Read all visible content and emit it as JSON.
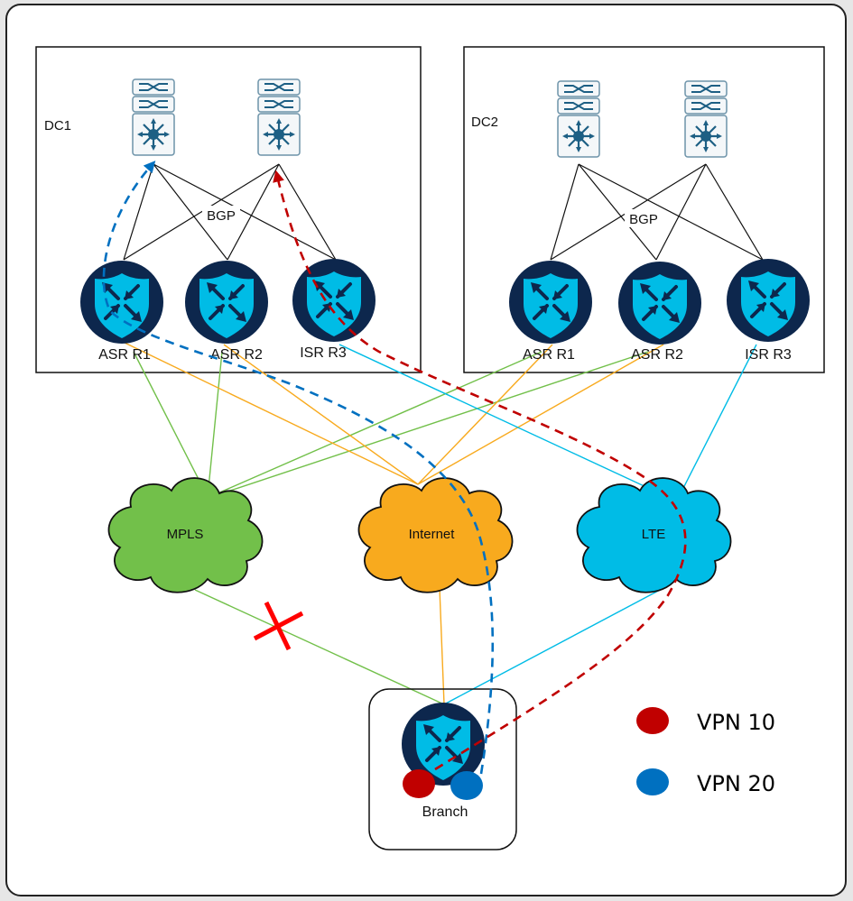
{
  "colors": {
    "mpls": "#72c04a",
    "internet": "#f8aa1e",
    "lte": "#00bce6",
    "vpn10": "#c00000",
    "vpn20": "#0070c0",
    "router_dark": "#0d274d",
    "router_shield": "#00bce6",
    "switch": "#1d5f84",
    "failure_x": "#ff0000"
  },
  "datacenters": [
    {
      "label": "DC1",
      "bgp_label": "BGP",
      "routers": [
        {
          "label": "ASR R1"
        },
        {
          "label": "ASR R2"
        },
        {
          "label": "ISR R3"
        }
      ],
      "switches": [
        {
          "name": "core-switch-1"
        },
        {
          "name": "core-switch-2"
        }
      ]
    },
    {
      "label": "DC2",
      "bgp_label": "BGP",
      "routers": [
        {
          "label": "ASR R1"
        },
        {
          "label": "ASR R2"
        },
        {
          "label": "ISR R3"
        }
      ],
      "switches": [
        {
          "name": "core-switch-1"
        },
        {
          "name": "core-switch-2"
        }
      ]
    }
  ],
  "transports": [
    {
      "label": "MPLS",
      "key": "mpls"
    },
    {
      "label": "Internet",
      "key": "internet"
    },
    {
      "label": "LTE",
      "key": "lte"
    }
  ],
  "branch": {
    "label": "Branch"
  },
  "failures": [
    {
      "link": "MPLS-Branch",
      "marker": "red-x"
    }
  ],
  "legend": [
    {
      "label": "VPN 10",
      "color_key": "vpn10"
    },
    {
      "label": "VPN 20",
      "color_key": "vpn20"
    }
  ]
}
